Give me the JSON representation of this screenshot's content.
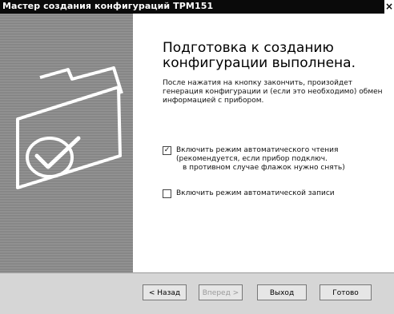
{
  "window": {
    "title": "Мастер создания конфигураций ТРМ151",
    "close_glyph": "×"
  },
  "side": {
    "icon": "folder-check-icon"
  },
  "content": {
    "heading": "Подготовка к созданию конфигурации выполнена.",
    "description": "После нажатия на кнопку закончить, произойдет генерация конфигурации и (если это необходимо) обмен информацией с прибором.",
    "auto_read": {
      "checked": true,
      "check_glyph": "✓",
      "label": "Включить режим автоматического чтения",
      "note_line1": "(рекомендуется, если прибор подключ.",
      "note_line2": "в противном случае флажок нужно снять)"
    },
    "auto_write": {
      "checked": false,
      "label": "Включить режим автоматической записи"
    }
  },
  "buttons": {
    "back": "< Назад",
    "next": "Вперед >",
    "exit": "Выход",
    "done": "Готово"
  }
}
